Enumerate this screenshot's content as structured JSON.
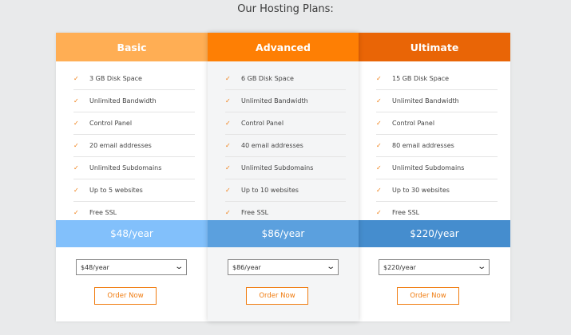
{
  "page": {
    "title": "Our Hosting Plans:"
  },
  "colors": {
    "accent": "#f07c10",
    "header_basic": "#ffae54",
    "header_advanced": "#fe7f04",
    "header_ultimate": "#e96506",
    "price_basic": "#82c0fb",
    "price_advanced": "#5ba0de",
    "price_ultimate": "#458dce"
  },
  "plans": [
    {
      "name": "Basic",
      "features": [
        "3 GB Disk Space",
        "Unlimited Bandwidth",
        "Control Panel",
        "20 email addresses",
        "Unlimited Subdomains",
        "Up to 5 websites",
        "Free SSL"
      ],
      "price": "$48/year",
      "selected_option": "$48/year",
      "order_label": "Order Now"
    },
    {
      "name": "Advanced",
      "features": [
        "6 GB Disk Space",
        "Unlimited Bandwidth",
        "Control Panel",
        "40 email addresses",
        "Unlimited Subdomains",
        "Up to 10 websites",
        "Free SSL"
      ],
      "price": "$86/year",
      "selected_option": "$86/year",
      "order_label": "Order Now"
    },
    {
      "name": "Ultimate",
      "features": [
        "15 GB Disk Space",
        "Unlimited Bandwidth",
        "Control Panel",
        "80 email addresses",
        "Unlimited Subdomains",
        "Up to 30 websites",
        "Free SSL"
      ],
      "price": "$220/year",
      "selected_option": "$220/year",
      "order_label": "Order Now"
    }
  ],
  "icons": {
    "feature": "check-icon",
    "select": "chevron-down-icon"
  }
}
